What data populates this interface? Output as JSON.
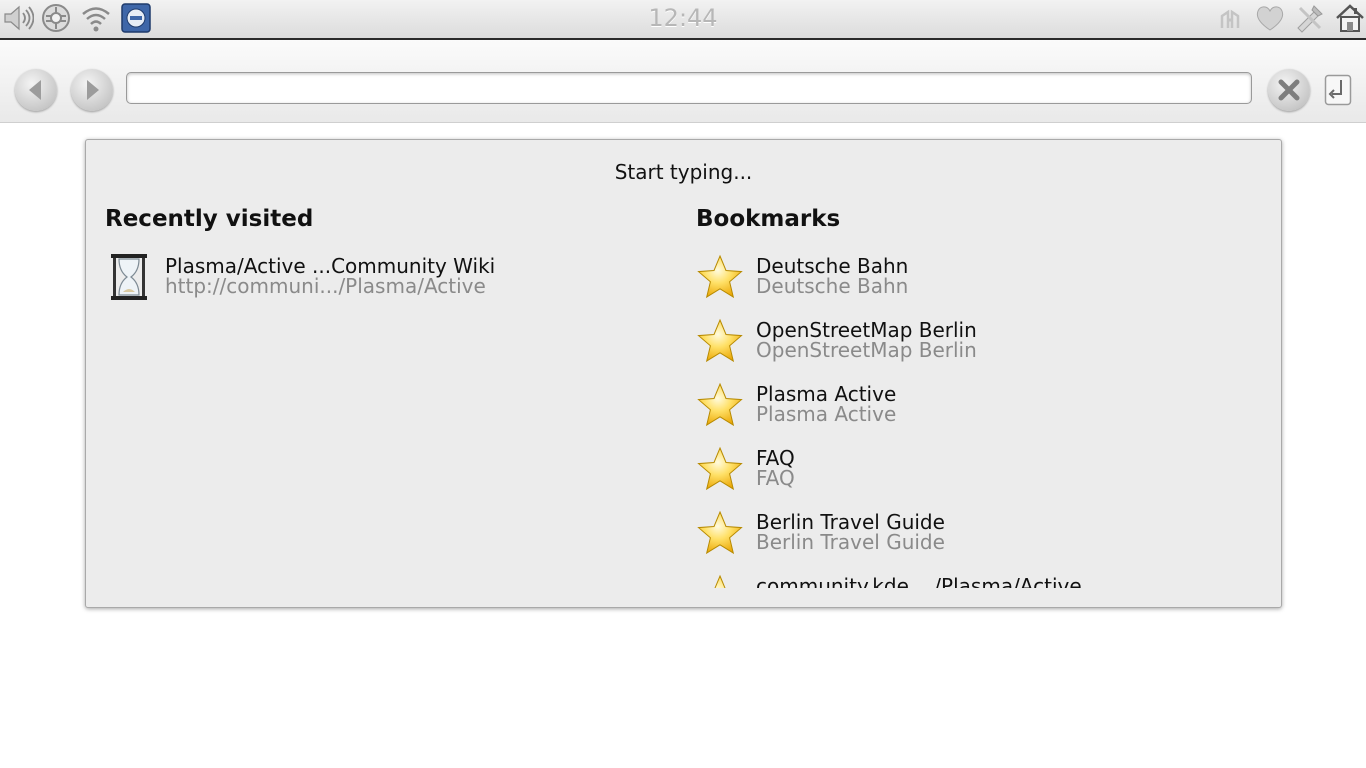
{
  "statusbar": {
    "time": "12:44",
    "left_icons": [
      "volume-icon",
      "network-icon",
      "wifi-icon",
      "task-manager-icon"
    ],
    "right_icons": [
      "connect-icon",
      "favorite-heart-icon",
      "tools-icon",
      "home-icon"
    ]
  },
  "toolbar": {
    "url_value": "",
    "url_placeholder": ""
  },
  "panel": {
    "hint": "Start typing...",
    "recent_title": "Recently visited",
    "bookmarks_title": "Bookmarks",
    "recent": [
      {
        "title": "Plasma/Active ...Community Wiki",
        "url": "http://communi.../Plasma/Active"
      }
    ],
    "bookmarks": [
      {
        "title": "Deutsche Bahn",
        "subtitle": "Deutsche Bahn"
      },
      {
        "title": "OpenStreetMap Berlin",
        "subtitle": "OpenStreetMap Berlin"
      },
      {
        "title": "Plasma Active",
        "subtitle": "Plasma Active"
      },
      {
        "title": "FAQ",
        "subtitle": "FAQ"
      },
      {
        "title": "Berlin Travel Guide",
        "subtitle": "Berlin Travel Guide"
      },
      {
        "title": "community.kde..../Plasma/Active",
        "subtitle": ""
      }
    ]
  }
}
